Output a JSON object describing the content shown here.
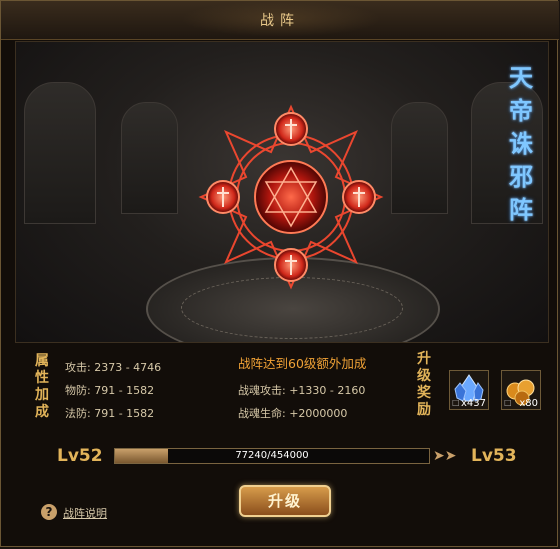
{
  "window": {
    "title": "战阵"
  },
  "formation": {
    "name_chars": [
      "天",
      "帝",
      "诛",
      "邪",
      "阵"
    ]
  },
  "attributes": {
    "heading_chars": [
      "属",
      "性",
      "加",
      "成"
    ],
    "lines": [
      "攻击: 2373 - 4746",
      "物防: 791 - 1582",
      "法防: 791 - 1582"
    ]
  },
  "bonus": {
    "title": "战阵达到60级额外加成",
    "lines": [
      "战魂攻击: +1330 - 2160",
      "战魂生命: +2000000"
    ]
  },
  "rewards": {
    "heading_chars": [
      "升",
      "级",
      "奖",
      "励"
    ],
    "items": [
      {
        "icon": "blue-crystal-icon",
        "count": "x437"
      },
      {
        "icon": "gold-ore-icon",
        "count": "x80"
      }
    ]
  },
  "level": {
    "current": "Lv52",
    "next": "Lv53",
    "progress_text": "77240/454000",
    "progress": 0.17
  },
  "actions": {
    "upgrade_label": "升级",
    "help_label": "战阵说明",
    "help_icon": "?"
  },
  "colors": {
    "accent": "#e2b45a",
    "bonus": "#f0a236",
    "title_blue": "#7fc7ff",
    "sigil_red": "#e8342a"
  }
}
